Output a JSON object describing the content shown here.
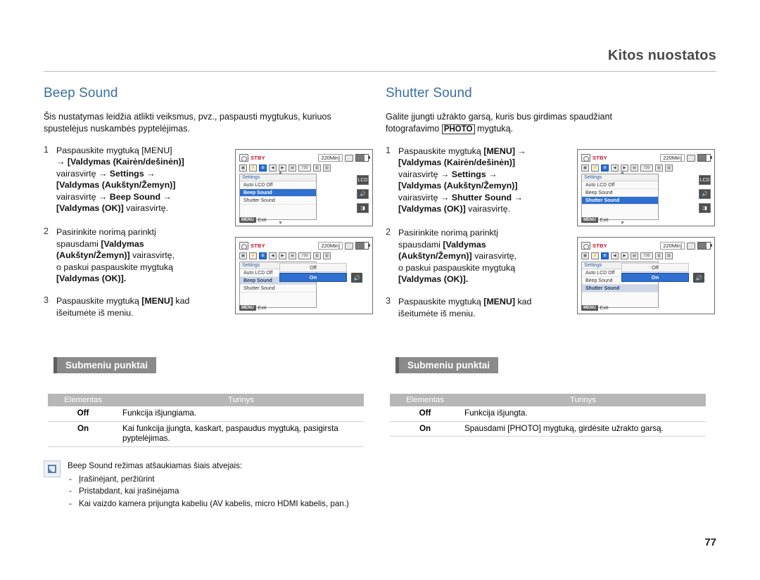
{
  "header": {
    "title": "Kitos nuostatos"
  },
  "page_number": "77",
  "left": {
    "section_title": "Beep Sound",
    "intro": "Šis nustatymas leidžia atlikti veiksmus, pvz., paspausti mygtukus, kuriuos spustelėjus nuskambės pyptelėjimas.",
    "steps": [
      {
        "num": "1",
        "lines": [
          "Paspauskite mygtuką [MENU]",
          "→ [Valdymas (Kairėn/dešinėn)]",
          "vairasvirtę → Settings →",
          "[Valdymas (Aukštyn/Žemyn)]",
          "vairasvirtę → Beep Sound →",
          "[Valdymas (OK)] vairasvirtę."
        ]
      },
      {
        "num": "2",
        "lines": [
          "Pasirinkite norimą parinktį",
          "spausdami [Valdymas",
          "(Aukštyn/Žemyn)] vairasvirtę,",
          "o paskui paspauskite mygtuką",
          "[Valdymas (OK)]."
        ]
      },
      {
        "num": "3",
        "lines": [
          "Paspauskite mygtuką [MENU] kad",
          "išeitumėte iš meniu."
        ]
      }
    ],
    "screen1": {
      "stby": "STBY",
      "rec_time": "220Min]",
      "menu_header": "Settings",
      "items": [
        "Auto LCD Off",
        "Beep Sound",
        "Shutter Sound"
      ],
      "selected": "Beep Sound",
      "exit_key": "MENU",
      "exit_label": "Exit"
    },
    "screen2": {
      "stby": "STBY",
      "rec_time": "220Min]",
      "menu_header": "Settings",
      "items": [
        "Auto LCD Off",
        "Beep Sound",
        "Shutter Sound"
      ],
      "selected": "Beep Sound",
      "options": [
        "Off",
        "On"
      ],
      "selected_option": "On",
      "exit_key": "MENU",
      "exit_label": "Exit"
    },
    "submenu_heading": "Submeniu punktai",
    "table": {
      "headers": [
        "Elementas",
        "Turinys"
      ],
      "rows": [
        {
          "key": "Off",
          "value": "Funkcija išjungiama."
        },
        {
          "key": "On",
          "value": "Kai funkcija įjungta, kaskart, paspaudus mygtuką, pasigirsta pyptelėjimas."
        }
      ]
    }
  },
  "right": {
    "section_title": "Shutter Sound",
    "intro": "Galite įjungti užrakto garsą, kuris bus girdimas spaudžiant fotografavimo [PHOTO] mygtuką.",
    "steps": [
      {
        "num": "1",
        "lines": [
          "Paspauskite mygtuką [MENU] →",
          "[Valdymas (Kairėn/dešinėn)]",
          "vairasvirtę → Settings →",
          "[Valdymas (Aukštyn/Žemyn)]",
          "vairasvirtę → Shutter Sound →",
          "[Valdymas (OK)] vairasvirtę."
        ]
      },
      {
        "num": "2",
        "lines": [
          "Pasirinkite norimą parinktį",
          "spausdami [Valdymas",
          "(Aukštyn/Žemyn)] vairasvirtę,",
          "o paskui paspauskite mygtuką",
          "[Valdymas (OK)]."
        ]
      },
      {
        "num": "3",
        "lines": [
          "Paspauskite mygtuką [MENU] kad",
          "išeitumėte iš meniu."
        ]
      }
    ],
    "screen1": {
      "stby": "STBY",
      "rec_time": "220Min]",
      "menu_header": "Settings",
      "items": [
        "Auto LCD Off",
        "Beep Sound",
        "Shutter Sound"
      ],
      "selected": "Shutter Sound",
      "exit_key": "MENU",
      "exit_label": "Exit"
    },
    "screen2": {
      "stby": "STBY",
      "rec_time": "220Min]",
      "menu_header": "Settings",
      "items": [
        "Auto LCD Off",
        "Beep Sound",
        "Shutter Sound"
      ],
      "selected": "Shutter Sound",
      "options": [
        "Off",
        "On"
      ],
      "selected_option": "On",
      "exit_key": "MENU",
      "exit_label": "Exit"
    },
    "submenu_heading": "Submeniu punktai",
    "table": {
      "headers": [
        "Elementas",
        "Turinys"
      ],
      "rows": [
        {
          "key": "Off",
          "value": "Funkcija išjungta."
        },
        {
          "key": "On",
          "value": "Spausdami [PHOTO] mygtuką, girdėsite užrakto garsą."
        }
      ]
    }
  },
  "note": {
    "intro": "Beep Sound režimas atšaukiamas šiais atvejais:",
    "items": [
      "Įrašinėjant, peržiūrint",
      "Pristabdant, kai įrašinėjama",
      "Kai vaizdo kamera prijungta kabeliu (AV kabelis, micro HDMI kabelis, pan.)"
    ]
  },
  "colors": {
    "accent_blue": "#3a6ea5",
    "selection_blue": "#2f6fd0",
    "stby_red": "#c8102e",
    "header_gray": "#4a4a4a",
    "table_header_gray": "#b7b7b7"
  }
}
